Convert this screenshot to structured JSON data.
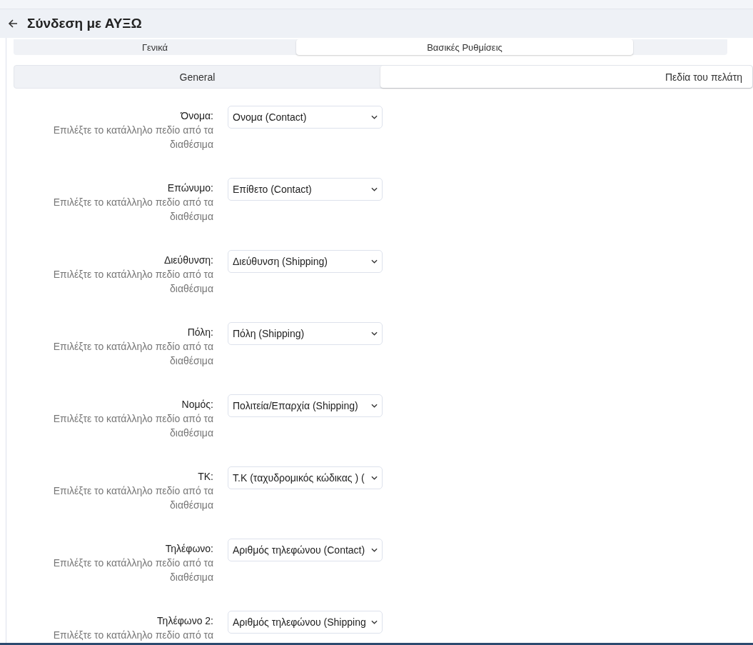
{
  "header": {
    "title": "Σύνδεση με ΑΥΞΩ"
  },
  "top_tabs": [
    {
      "label": "Γενικά",
      "selected": false
    },
    {
      "label": "Βασικές Ρυθμίσεις",
      "selected": true
    }
  ],
  "sub_tabs": [
    {
      "label": "General",
      "selected": false
    },
    {
      "label": "Πεδία του πελάτη",
      "selected": true
    }
  ],
  "fields": [
    {
      "label": "Όνομα:",
      "hint": "Επιλέξτε το κατάλληλο πεδίο από τα διαθέσιμα",
      "value": "Ονομα (Contact)"
    },
    {
      "label": "Επώνυμο:",
      "hint": "Επιλέξτε το κατάλληλο πεδίο από τα διαθέσιμα",
      "value": "Επίθετο (Contact)"
    },
    {
      "label": "Διεύθυνση:",
      "hint": "Επιλέξτε το κατάλληλο πεδίο από τα διαθέσιμα",
      "value": "Διεύθυνση (Shipping)"
    },
    {
      "label": "Πόλη:",
      "hint": "Επιλέξτε το κατάλληλο πεδίο από τα διαθέσιμα",
      "value": "Πόλη (Shipping)"
    },
    {
      "label": "Νομός:",
      "hint": "Επιλέξτε το κατάλληλο πεδίο από τα διαθέσιμα",
      "value": "Πολιτεία/Επαρχία (Shipping)"
    },
    {
      "label": "ΤΚ:",
      "hint": "Επιλέξτε το κατάλληλο πεδίο από τα διαθέσιμα",
      "value": "Τ.Κ (ταχυδρομικός κώδικας ) ("
    },
    {
      "label": "Τηλέφωνο:",
      "hint": "Επιλέξτε το κατάλληλο πεδίο από τα διαθέσιμα",
      "value": "Αριθμός τηλεφώνου (Contact)"
    },
    {
      "label": "Τηλέφωνο 2:",
      "hint": "Επιλέξτε το κατάλληλο πεδίο από τα",
      "value": "Αριθμός τηλεφώνου (Shipping"
    }
  ]
}
